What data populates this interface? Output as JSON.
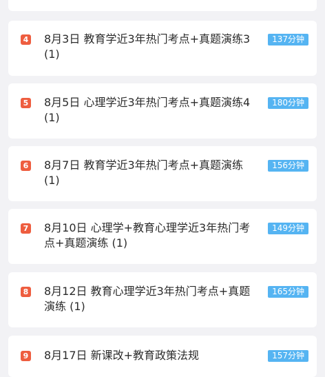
{
  "lessons": [
    {
      "index": "4",
      "title": "8月3日 教育学近3年热门考点+真题演练3 (1)",
      "duration": "137分钟"
    },
    {
      "index": "5",
      "title": "8月5日 心理学近3年热门考点+真题演练4 (1)",
      "duration": "180分钟"
    },
    {
      "index": "6",
      "title": "8月7日 教育学近3年热门考点+真题演练 (1)",
      "duration": "156分钟"
    },
    {
      "index": "7",
      "title": "8月10日 心理学+教育心理学近3年热门考点+真题演练 (1)",
      "duration": "149分钟"
    },
    {
      "index": "8",
      "title": "8月12日 教育心理学近3年热门考点+真题演练 (1)",
      "duration": "165分钟"
    },
    {
      "index": "9",
      "title": "8月17日 新课改+教育政策法规",
      "duration": "157分钟"
    }
  ],
  "colors": {
    "background": "#f2f2f5",
    "card": "#ffffff",
    "index_badge": "#ee5d3f",
    "duration_badge": "#55b4f2",
    "text": "#2b2b2b"
  }
}
